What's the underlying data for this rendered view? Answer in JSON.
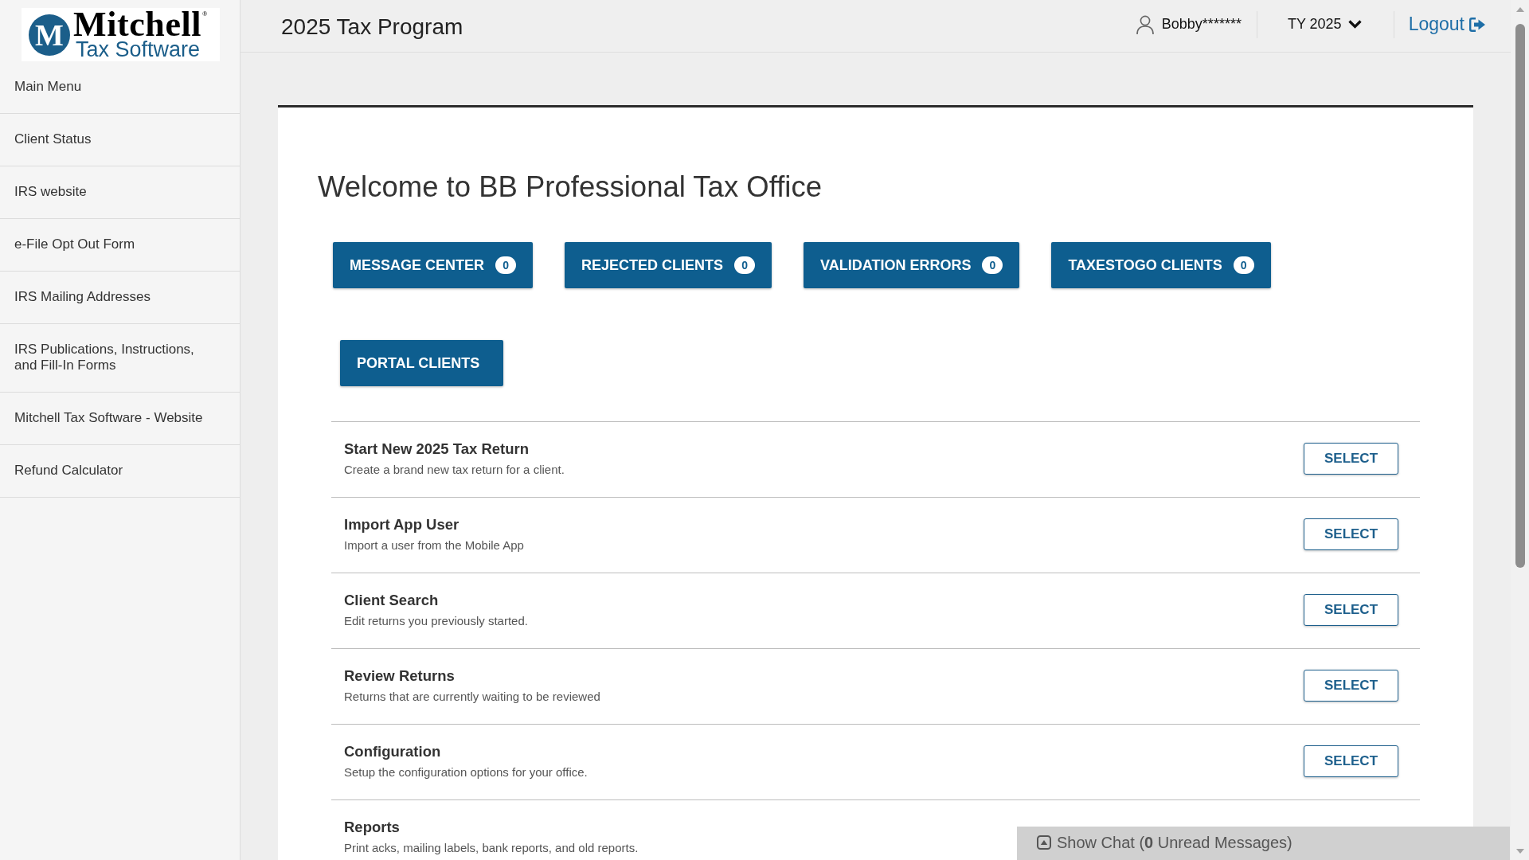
{
  "logo": {
    "emblem": "M",
    "name": "Mitchell",
    "mark": "®",
    "tagline": "Tax Software"
  },
  "sidebar": {
    "items": [
      "Main Menu",
      "Client Status",
      "IRS website",
      "e-File Opt Out Form",
      "IRS Mailing Addresses",
      "IRS Publications, Instructions, and Fill-In Forms",
      "Mitchell Tax Software - Website",
      "Refund Calculator"
    ]
  },
  "header": {
    "title": "2025 Tax Program",
    "user": "Bobby*******",
    "tax_year": "TY 2025",
    "logout": "Logout"
  },
  "welcome": "Welcome to BB Professional Tax Office",
  "button_rows": [
    [
      {
        "label": "MESSAGE CENTER",
        "count": "0"
      },
      {
        "label": "REJECTED CLIENTS",
        "count": "0"
      },
      {
        "label": "VALIDATION ERRORS",
        "count": "0"
      },
      {
        "label": "TAXESTOGO CLIENTS",
        "count": "0"
      }
    ],
    [
      {
        "label": "PORTAL CLIENTS"
      }
    ]
  ],
  "actions": [
    {
      "title": "Start New 2025 Tax Return",
      "description": "Create a brand new tax return for a client.",
      "button": "SELECT"
    },
    {
      "title": "Import App User",
      "description": "Import a user from the Mobile App",
      "button": "SELECT"
    },
    {
      "title": "Client Search",
      "description": "Edit returns you previously started.",
      "button": "SELECT"
    },
    {
      "title": "Review Returns",
      "description": "Returns that are currently waiting to be reviewed",
      "button": "SELECT"
    },
    {
      "title": "Configuration",
      "description": "Setup the configuration options for your office.",
      "button": "SELECT"
    },
    {
      "title": "Reports",
      "description": "Print acks, mailing labels, bank reports, and old reports."
    }
  ],
  "chat_bar": {
    "label": "Show Chat (**0** Unread Messages)"
  }
}
